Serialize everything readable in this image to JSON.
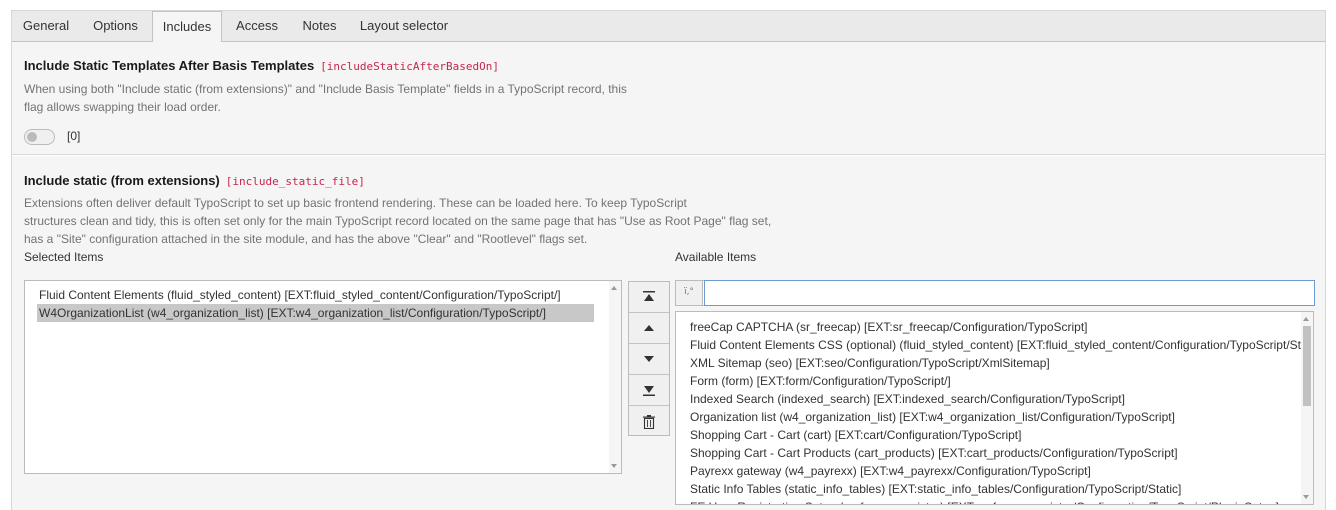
{
  "tabs": [
    {
      "label": "General",
      "active": false
    },
    {
      "label": "Options",
      "active": false
    },
    {
      "label": "Includes",
      "active": true
    },
    {
      "label": "Access",
      "active": false
    },
    {
      "label": "Notes",
      "active": false
    },
    {
      "label": "Layout selector",
      "active": false
    }
  ],
  "section1": {
    "title": "Include Static Templates After Basis Templates",
    "field_code": "[includeStaticAfterBasedOn]",
    "description_line1": "When using both \"Include static (from extensions)\" and \"Include Basis Template\" fields in a TypoScript record, this",
    "description_line2": "flag allows swapping their load order.",
    "toggle_checked": false,
    "toggle_value": "[0]"
  },
  "section2": {
    "title": "Include static (from extensions)",
    "field_code": "[include_static_file]",
    "description_line1": "Extensions often deliver default TypoScript to set up basic frontend rendering. These can be loaded here. To keep TypoScript",
    "description_line2": "structures clean and tidy, this is often set only for the main TypoScript record located on the same page that has \"Use as Root Page\" flag set,",
    "description_line3": "has a \"Site\" configuration attached in the site module, and has the above \"Clear\" and \"Rootlevel\" flags set.",
    "selected_label": "Selected Items",
    "available_label": "Available Items",
    "selected_items": [
      "Fluid Content Elements (fluid_styled_content) [EXT:fluid_styled_content/Configuration/TypoScript/]",
      "W4OrganizationList (w4_organization_list) [EXT:w4_organization_list/Configuration/TypoScript/]"
    ],
    "selected_highlight_index": 1,
    "filter_addon": "ï,°",
    "filter_value": "",
    "available_items": [
      "freeCap CAPTCHA (sr_freecap) [EXT:sr_freecap/Configuration/TypoScript]",
      "Fluid Content Elements CSS (optional) (fluid_styled_content) [EXT:fluid_styled_content/Configuration/TypoScript/Styling/]",
      "XML Sitemap (seo) [EXT:seo/Configuration/TypoScript/XmlSitemap]",
      "Form (form) [EXT:form/Configuration/TypoScript/]",
      "Indexed Search (indexed_search) [EXT:indexed_search/Configuration/TypoScript]",
      "Organization list (w4_organization_list) [EXT:w4_organization_list/Configuration/TypoScript]",
      "Shopping Cart - Cart (cart) [EXT:cart/Configuration/TypoScript]",
      "Shopping Cart - Cart Products (cart_products) [EXT:cart_products/Configuration/TypoScript]",
      "Payrexx gateway (w4_payrexx) [EXT:w4_payrexx/Configuration/TypoScript]",
      "Static Info Tables (static_info_tables) [EXT:static_info_tables/Configuration/TypoScript/Static]",
      "FE User Registration Setup (sr_feuser_register) [EXT:sr_feuser_register/Configuration/TypoScript/PluginSetup]"
    ],
    "buttons": [
      {
        "icon": "move-to-top-icon"
      },
      {
        "icon": "move-up-icon"
      },
      {
        "icon": "move-down-icon"
      },
      {
        "icon": "move-to-bottom-icon"
      },
      {
        "icon": "trash-icon"
      }
    ]
  }
}
